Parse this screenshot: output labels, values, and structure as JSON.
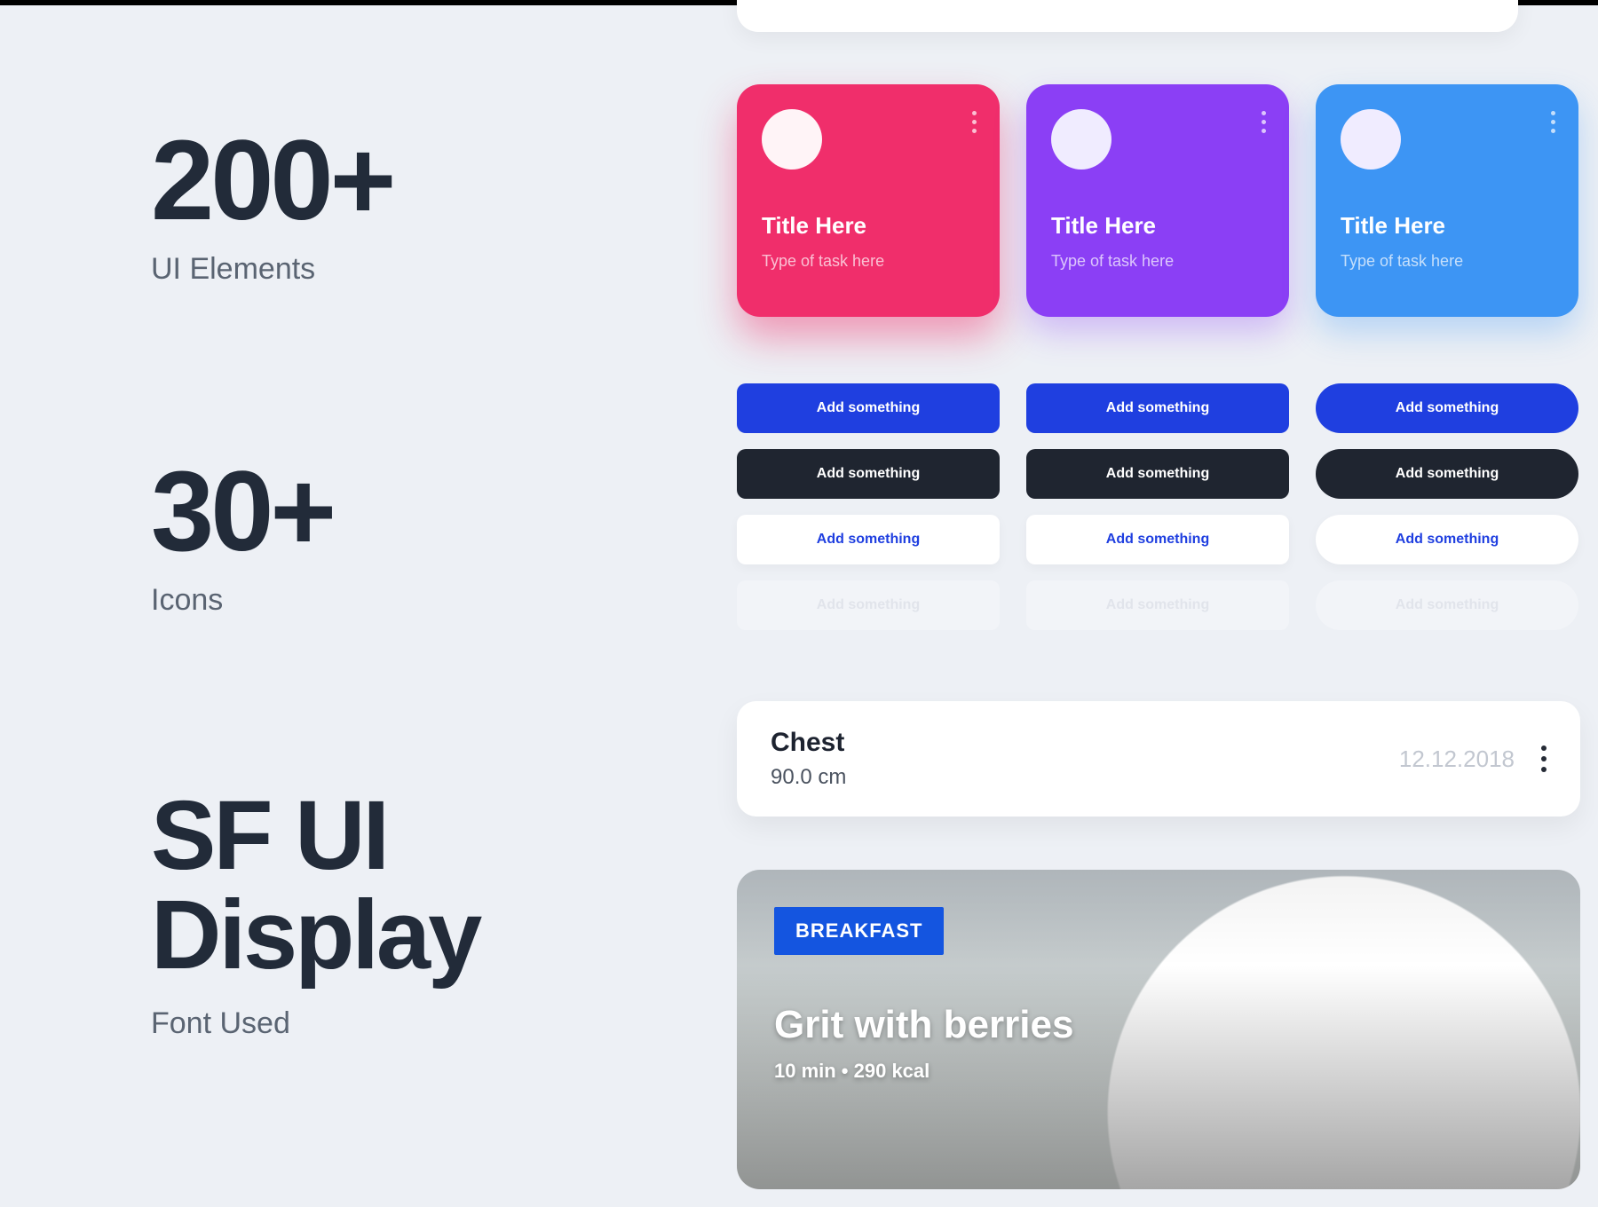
{
  "stats": {
    "elements_count": "200+",
    "elements_label": "UI Elements",
    "icons_count": "30+",
    "icons_label": "Icons",
    "font_title_1": "SF UI",
    "font_title_2": "Display",
    "font_sub": "Font Used"
  },
  "cards": [
    {
      "title": "Title Here",
      "subtitle": "Type of task here"
    },
    {
      "title": "Title Here",
      "subtitle": "Type of task here"
    },
    {
      "title": "Title Here",
      "subtitle": "Type of task here"
    }
  ],
  "button_label": "Add something",
  "measure": {
    "title": "Chest",
    "value": "90.0 cm",
    "date": "12.12.2018"
  },
  "meal": {
    "tag": "BREAKFAST",
    "name": "Grit with berries",
    "meta": "10 min • 290 kcal"
  }
}
